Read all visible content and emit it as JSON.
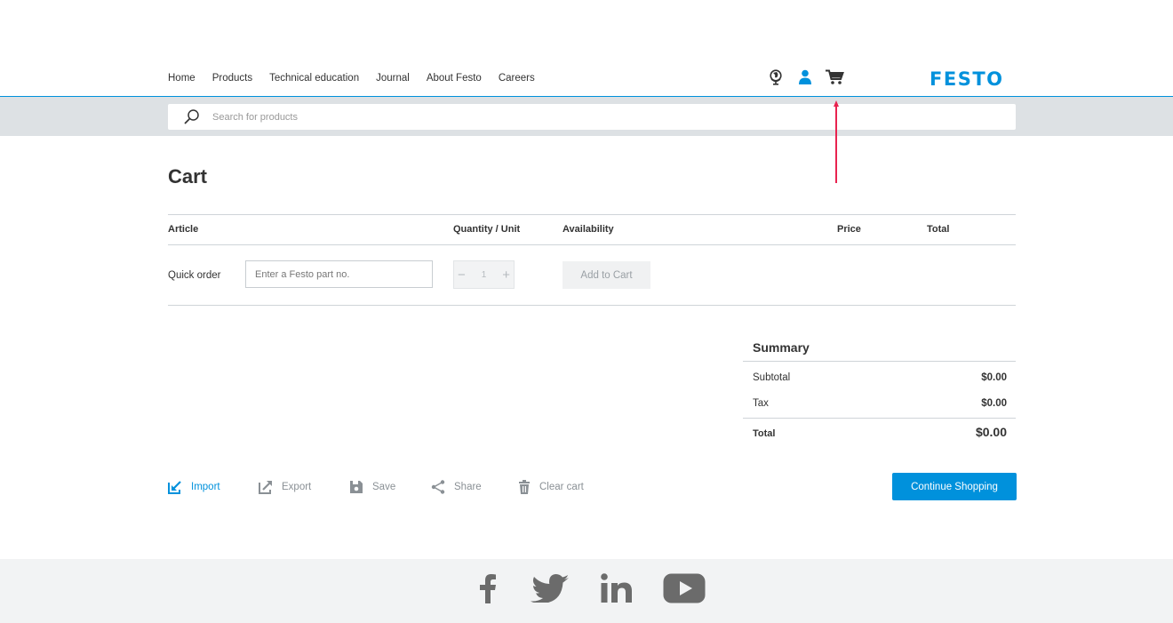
{
  "nav": {
    "items": [
      "Home",
      "Products",
      "Technical education",
      "Journal",
      "About Festo",
      "Careers"
    ]
  },
  "header": {
    "icons": [
      "globe-icon",
      "user-icon",
      "cart-icon"
    ],
    "logo": "FESTO"
  },
  "search": {
    "placeholder": "Search for products"
  },
  "cart": {
    "title": "Cart",
    "columns": {
      "article": "Article",
      "quantity": "Quantity / Unit",
      "availability": "Availability",
      "price": "Price",
      "total": "Total"
    },
    "quick_order": {
      "label": "Quick order",
      "placeholder": "Enter a Festo part no.",
      "quantity": "1",
      "add_button": "Add to Cart"
    }
  },
  "summary": {
    "title": "Summary",
    "subtotal_label": "Subtotal",
    "subtotal_value": "$0.00",
    "tax_label": "Tax",
    "tax_value": "$0.00",
    "total_label": "Total",
    "total_value": "$0.00"
  },
  "actions": {
    "import": "Import",
    "export": "Export",
    "save": "Save",
    "share": "Share",
    "clear": "Clear cart",
    "continue": "Continue Shopping"
  },
  "footer": {
    "social": [
      "facebook-icon",
      "twitter-icon",
      "linkedin-icon",
      "youtube-icon"
    ]
  },
  "colors": {
    "accent": "#0091dc",
    "annotation": "#e8234f",
    "search_band": "#dde1e4",
    "footer_bg": "#f2f3f4"
  }
}
